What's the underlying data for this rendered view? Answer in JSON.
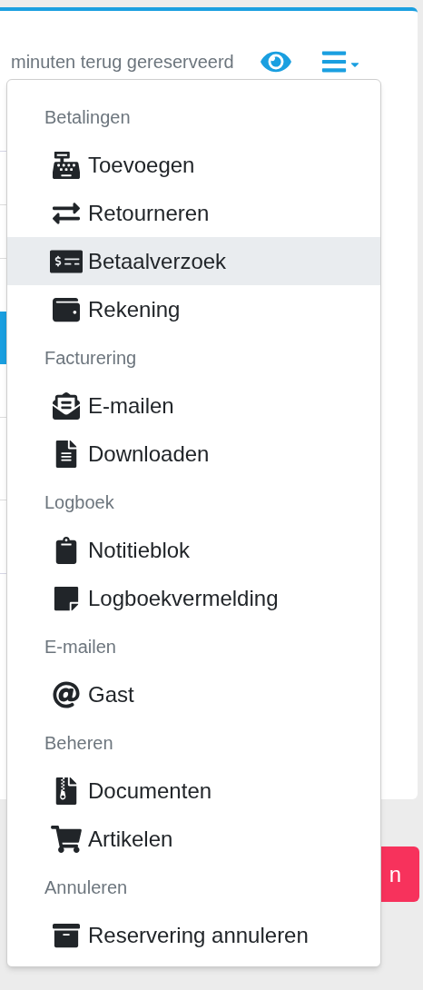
{
  "header": {
    "reserved_text": "minuten terug gereserveerd"
  },
  "menu": {
    "groups": [
      {
        "header": "Betalingen",
        "items": [
          {
            "label": "Toevoegen",
            "selected": false
          },
          {
            "label": "Retourneren",
            "selected": false
          },
          {
            "label": "Betaalverzoek",
            "selected": true
          },
          {
            "label": "Rekening",
            "selected": false
          }
        ]
      },
      {
        "header": "Facturering",
        "items": [
          {
            "label": "E-mailen",
            "selected": false
          },
          {
            "label": "Downloaden",
            "selected": false
          }
        ]
      },
      {
        "header": "Logboek",
        "items": [
          {
            "label": "Notitieblok",
            "selected": false
          },
          {
            "label": "Logboekvermelding",
            "selected": false
          }
        ]
      },
      {
        "header": "E-mailen",
        "items": [
          {
            "label": "Gast",
            "selected": false
          }
        ]
      },
      {
        "header": "Beheren",
        "items": [
          {
            "label": "Documenten",
            "selected": false
          },
          {
            "label": "Artikelen",
            "selected": false
          }
        ]
      },
      {
        "header": "Annuleren",
        "items": [
          {
            "label": "Reservering annuleren",
            "selected": false
          }
        ]
      }
    ]
  },
  "background_button": {
    "label": "n"
  }
}
